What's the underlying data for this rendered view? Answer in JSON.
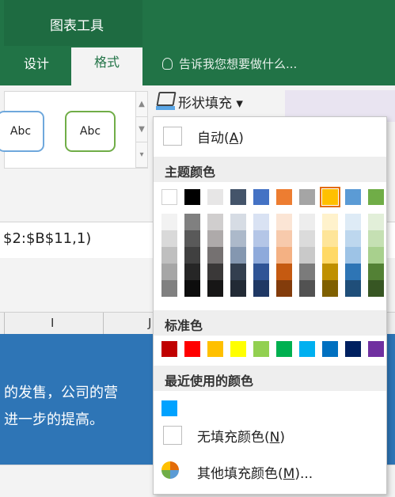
{
  "ribbon": {
    "context_title": "图表工具",
    "tabs": [
      {
        "label": "设计"
      },
      {
        "label": "格式"
      }
    ],
    "tell_me": "告诉我您想要做什么...",
    "shape_fill_label": "形状填充",
    "style_samples": [
      "Abc",
      "Abc"
    ]
  },
  "formula": {
    "text": "$2:$B$11,1)"
  },
  "columns": [
    "I",
    "J"
  ],
  "shape_text": [
    "的发售，公司的营",
    "进一步的提高。"
  ],
  "fill_menu": {
    "auto": {
      "label": "自动",
      "key": "A"
    },
    "theme_header": "主题颜色",
    "theme_colors_top": [
      "#ffffff",
      "#000000",
      "#e7e6e6",
      "#44546a",
      "#4472c4",
      "#ed7d31",
      "#a5a5a5",
      "#ffc000",
      "#5b9bd5",
      "#70ad47"
    ],
    "theme_shades": [
      [
        "#f2f2f2",
        "#d9d9d9",
        "#bfbfbf",
        "#a6a6a6",
        "#808080"
      ],
      [
        "#808080",
        "#595959",
        "#404040",
        "#262626",
        "#0d0d0d"
      ],
      [
        "#d0cece",
        "#aeaaaa",
        "#757171",
        "#3a3838",
        "#171616"
      ],
      [
        "#d6dce4",
        "#acb9ca",
        "#8497b0",
        "#333f4f",
        "#222a35"
      ],
      [
        "#d9e2f3",
        "#b4c6e7",
        "#8eaadb",
        "#2f5496",
        "#1f3864"
      ],
      [
        "#fbe5d5",
        "#f7caac",
        "#f4b183",
        "#c55a11",
        "#833c0b"
      ],
      [
        "#ededed",
        "#dbdbdb",
        "#c9c9c9",
        "#7b7b7b",
        "#525252"
      ],
      [
        "#fff2cc",
        "#fee599",
        "#ffd966",
        "#bf9000",
        "#7f6000"
      ],
      [
        "#deebf6",
        "#bdd7ee",
        "#9dc3e6",
        "#2e75b5",
        "#1f4e79"
      ],
      [
        "#e2efd9",
        "#c5e0b3",
        "#a8d08d",
        "#538135",
        "#375623"
      ]
    ],
    "selected_theme_color": "#ffc000",
    "standard_header": "标准色",
    "standard_colors": [
      "#c00000",
      "#ff0000",
      "#ffc000",
      "#ffff00",
      "#92d050",
      "#00b050",
      "#00b0f0",
      "#0070c0",
      "#002060",
      "#7030a0"
    ],
    "recent_header": "最近使用的颜色",
    "recent_colors": [
      "#00a2ff"
    ],
    "no_fill": {
      "label": "无填充颜色",
      "key": "N"
    },
    "more": {
      "label": "其他填充颜色",
      "key": "M",
      "suffix": "..."
    }
  }
}
